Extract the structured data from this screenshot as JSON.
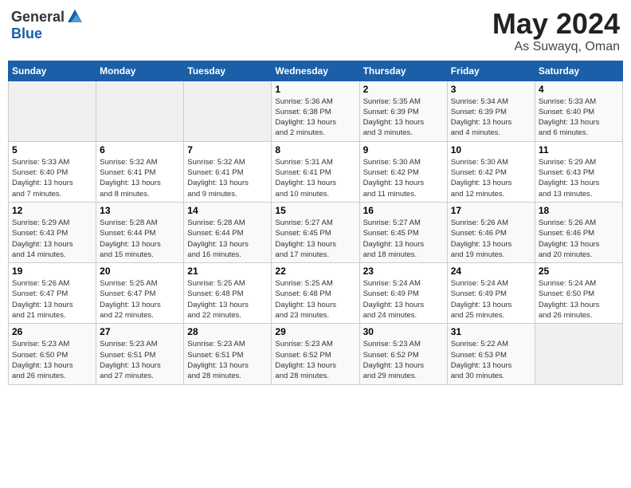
{
  "header": {
    "logo_general": "General",
    "logo_blue": "Blue",
    "month_title": "May 2024",
    "location": "As Suwayq, Oman"
  },
  "calendar": {
    "weekdays": [
      "Sunday",
      "Monday",
      "Tuesday",
      "Wednesday",
      "Thursday",
      "Friday",
      "Saturday"
    ],
    "weeks": [
      [
        {
          "day": "",
          "info": ""
        },
        {
          "day": "",
          "info": ""
        },
        {
          "day": "",
          "info": ""
        },
        {
          "day": "1",
          "info": "Sunrise: 5:36 AM\nSunset: 6:38 PM\nDaylight: 13 hours\nand 2 minutes."
        },
        {
          "day": "2",
          "info": "Sunrise: 5:35 AM\nSunset: 6:39 PM\nDaylight: 13 hours\nand 3 minutes."
        },
        {
          "day": "3",
          "info": "Sunrise: 5:34 AM\nSunset: 6:39 PM\nDaylight: 13 hours\nand 4 minutes."
        },
        {
          "day": "4",
          "info": "Sunrise: 5:33 AM\nSunset: 6:40 PM\nDaylight: 13 hours\nand 6 minutes."
        }
      ],
      [
        {
          "day": "5",
          "info": "Sunrise: 5:33 AM\nSunset: 6:40 PM\nDaylight: 13 hours\nand 7 minutes."
        },
        {
          "day": "6",
          "info": "Sunrise: 5:32 AM\nSunset: 6:41 PM\nDaylight: 13 hours\nand 8 minutes."
        },
        {
          "day": "7",
          "info": "Sunrise: 5:32 AM\nSunset: 6:41 PM\nDaylight: 13 hours\nand 9 minutes."
        },
        {
          "day": "8",
          "info": "Sunrise: 5:31 AM\nSunset: 6:41 PM\nDaylight: 13 hours\nand 10 minutes."
        },
        {
          "day": "9",
          "info": "Sunrise: 5:30 AM\nSunset: 6:42 PM\nDaylight: 13 hours\nand 11 minutes."
        },
        {
          "day": "10",
          "info": "Sunrise: 5:30 AM\nSunset: 6:42 PM\nDaylight: 13 hours\nand 12 minutes."
        },
        {
          "day": "11",
          "info": "Sunrise: 5:29 AM\nSunset: 6:43 PM\nDaylight: 13 hours\nand 13 minutes."
        }
      ],
      [
        {
          "day": "12",
          "info": "Sunrise: 5:29 AM\nSunset: 6:43 PM\nDaylight: 13 hours\nand 14 minutes."
        },
        {
          "day": "13",
          "info": "Sunrise: 5:28 AM\nSunset: 6:44 PM\nDaylight: 13 hours\nand 15 minutes."
        },
        {
          "day": "14",
          "info": "Sunrise: 5:28 AM\nSunset: 6:44 PM\nDaylight: 13 hours\nand 16 minutes."
        },
        {
          "day": "15",
          "info": "Sunrise: 5:27 AM\nSunset: 6:45 PM\nDaylight: 13 hours\nand 17 minutes."
        },
        {
          "day": "16",
          "info": "Sunrise: 5:27 AM\nSunset: 6:45 PM\nDaylight: 13 hours\nand 18 minutes."
        },
        {
          "day": "17",
          "info": "Sunrise: 5:26 AM\nSunset: 6:46 PM\nDaylight: 13 hours\nand 19 minutes."
        },
        {
          "day": "18",
          "info": "Sunrise: 5:26 AM\nSunset: 6:46 PM\nDaylight: 13 hours\nand 20 minutes."
        }
      ],
      [
        {
          "day": "19",
          "info": "Sunrise: 5:26 AM\nSunset: 6:47 PM\nDaylight: 13 hours\nand 21 minutes."
        },
        {
          "day": "20",
          "info": "Sunrise: 5:25 AM\nSunset: 6:47 PM\nDaylight: 13 hours\nand 22 minutes."
        },
        {
          "day": "21",
          "info": "Sunrise: 5:25 AM\nSunset: 6:48 PM\nDaylight: 13 hours\nand 22 minutes."
        },
        {
          "day": "22",
          "info": "Sunrise: 5:25 AM\nSunset: 6:48 PM\nDaylight: 13 hours\nand 23 minutes."
        },
        {
          "day": "23",
          "info": "Sunrise: 5:24 AM\nSunset: 6:49 PM\nDaylight: 13 hours\nand 24 minutes."
        },
        {
          "day": "24",
          "info": "Sunrise: 5:24 AM\nSunset: 6:49 PM\nDaylight: 13 hours\nand 25 minutes."
        },
        {
          "day": "25",
          "info": "Sunrise: 5:24 AM\nSunset: 6:50 PM\nDaylight: 13 hours\nand 26 minutes."
        }
      ],
      [
        {
          "day": "26",
          "info": "Sunrise: 5:23 AM\nSunset: 6:50 PM\nDaylight: 13 hours\nand 26 minutes."
        },
        {
          "day": "27",
          "info": "Sunrise: 5:23 AM\nSunset: 6:51 PM\nDaylight: 13 hours\nand 27 minutes."
        },
        {
          "day": "28",
          "info": "Sunrise: 5:23 AM\nSunset: 6:51 PM\nDaylight: 13 hours\nand 28 minutes."
        },
        {
          "day": "29",
          "info": "Sunrise: 5:23 AM\nSunset: 6:52 PM\nDaylight: 13 hours\nand 28 minutes."
        },
        {
          "day": "30",
          "info": "Sunrise: 5:23 AM\nSunset: 6:52 PM\nDaylight: 13 hours\nand 29 minutes."
        },
        {
          "day": "31",
          "info": "Sunrise: 5:22 AM\nSunset: 6:53 PM\nDaylight: 13 hours\nand 30 minutes."
        },
        {
          "day": "",
          "info": ""
        }
      ]
    ]
  }
}
